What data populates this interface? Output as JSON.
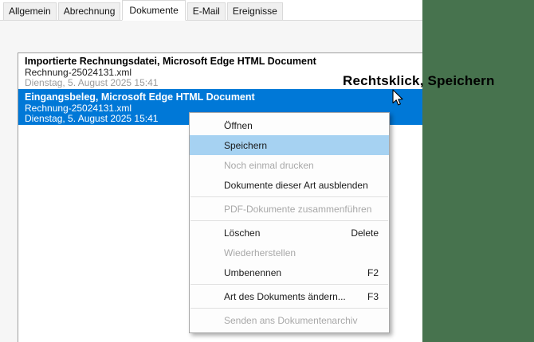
{
  "colors": {
    "backdrop_green": "#47734e",
    "selection_blue": "#0078d7",
    "menu_highlight_blue": "#a6d2f2",
    "panel_gray": "#f6f6f6"
  },
  "tabs": {
    "active": "Dokumente",
    "items": [
      {
        "label": "Allgemein"
      },
      {
        "label": "Abrechnung"
      },
      {
        "label": "Dokumente"
      },
      {
        "label": "E-Mail"
      },
      {
        "label": "Ereignisse"
      }
    ]
  },
  "document_list": {
    "items": [
      {
        "title": "Importierte Rechnungsdatei, Microsoft Edge HTML Document",
        "filename": "Rechnung-25024131.xml",
        "date": "Dienstag, 5. August 2025 15:41",
        "selected": false
      },
      {
        "title": "Eingangsbeleg, Microsoft Edge HTML Document",
        "filename": "Rechnung-25024131.xml",
        "date": "Dienstag, 5. August 2025 15:41",
        "selected": true
      }
    ]
  },
  "context_menu": {
    "items": [
      {
        "label": "Öffnen",
        "shortcut": "",
        "state": "normal"
      },
      {
        "label": "Speichern",
        "shortcut": "",
        "state": "highlighted"
      },
      {
        "label": "Noch einmal drucken",
        "shortcut": "",
        "state": "disabled"
      },
      {
        "label": "Dokumente dieser Art ausblenden",
        "shortcut": "",
        "state": "normal"
      },
      {
        "label": "PDF-Dokumente zusammenführen",
        "shortcut": "",
        "state": "disabled"
      },
      {
        "label": "Löschen",
        "shortcut": "Delete",
        "state": "normal"
      },
      {
        "label": "Wiederherstellen",
        "shortcut": "",
        "state": "disabled"
      },
      {
        "label": "Umbenennen",
        "shortcut": "F2",
        "state": "normal"
      },
      {
        "label": "Art des Dokuments ändern...",
        "shortcut": "F3",
        "state": "normal"
      },
      {
        "label": "Senden ans Dokumentenarchiv",
        "shortcut": "",
        "state": "disabled"
      }
    ]
  },
  "annotation": {
    "text": "Rechtsklick, Speichern"
  }
}
